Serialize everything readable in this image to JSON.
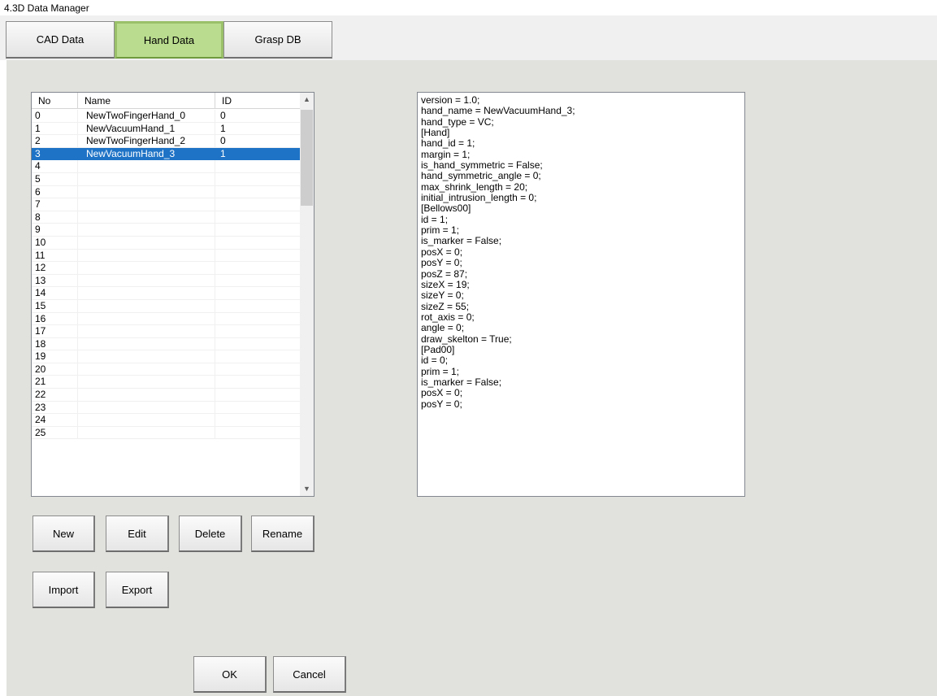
{
  "window": {
    "title": "4.3D Data Manager"
  },
  "tabs": [
    {
      "label": "CAD Data",
      "active": false
    },
    {
      "label": "Hand Data",
      "active": true
    },
    {
      "label": "Grasp DB",
      "active": false
    }
  ],
  "hand_list": {
    "columns": [
      "No",
      "Name",
      "ID"
    ],
    "rows": [
      {
        "no": "0",
        "name": "NewTwoFingerHand_0",
        "id": "0"
      },
      {
        "no": "1",
        "name": "NewVacuumHand_1",
        "id": "1"
      },
      {
        "no": "2",
        "name": "NewTwoFingerHand_2",
        "id": "0"
      },
      {
        "no": "3",
        "name": "NewVacuumHand_3",
        "id": "1",
        "selected": true
      },
      {
        "no": "4",
        "name": "",
        "id": ""
      },
      {
        "no": "5",
        "name": "",
        "id": ""
      },
      {
        "no": "6",
        "name": "",
        "id": ""
      },
      {
        "no": "7",
        "name": "",
        "id": ""
      },
      {
        "no": "8",
        "name": "",
        "id": ""
      },
      {
        "no": "9",
        "name": "",
        "id": ""
      },
      {
        "no": "10",
        "name": "",
        "id": ""
      },
      {
        "no": "11",
        "name": "",
        "id": ""
      },
      {
        "no": "12",
        "name": "",
        "id": ""
      },
      {
        "no": "13",
        "name": "",
        "id": ""
      },
      {
        "no": "14",
        "name": "",
        "id": ""
      },
      {
        "no": "15",
        "name": "",
        "id": ""
      },
      {
        "no": "16",
        "name": "",
        "id": ""
      },
      {
        "no": "17",
        "name": "",
        "id": ""
      },
      {
        "no": "18",
        "name": "",
        "id": ""
      },
      {
        "no": "19",
        "name": "",
        "id": ""
      },
      {
        "no": "20",
        "name": "",
        "id": ""
      },
      {
        "no": "21",
        "name": "",
        "id": ""
      },
      {
        "no": "22",
        "name": "",
        "id": ""
      },
      {
        "no": "23",
        "name": "",
        "id": ""
      },
      {
        "no": "24",
        "name": "",
        "id": ""
      },
      {
        "no": "25",
        "name": "",
        "id": ""
      }
    ],
    "scroll_up_icon": "chevron-up-icon",
    "scroll_down_icon": "chevron-down-icon"
  },
  "hand_detail_text": [
    "version = 1.0;",
    "hand_name = NewVacuumHand_3;",
    "hand_type = VC;",
    "[Hand]",
    "hand_id = 1;",
    "margin = 1;",
    "is_hand_symmetric = False;",
    "hand_symmetric_angle = 0;",
    "max_shrink_length = 20;",
    "initial_intrusion_length = 0;",
    "[Bellows00]",
    "id = 1;",
    "prim = 1;",
    "is_marker = False;",
    "posX = 0;",
    "posY = 0;",
    "posZ = 87;",
    "sizeX = 19;",
    "sizeY = 0;",
    "sizeZ = 55;",
    "rot_axis = 0;",
    "angle = 0;",
    "draw_skelton = True;",
    "[Pad00]",
    "id = 0;",
    "prim = 1;",
    "is_marker = False;",
    "posX = 0;",
    "posY = 0;"
  ],
  "buttons": {
    "new": "New",
    "edit": "Edit",
    "delete": "Delete",
    "rename": "Rename",
    "import": "Import",
    "export": "Export",
    "ok": "OK",
    "cancel": "Cancel"
  },
  "colors": {
    "active_tab": "#b9dc8e",
    "selection": "#1f73c6",
    "panel_bg": "#e1e1dd"
  }
}
